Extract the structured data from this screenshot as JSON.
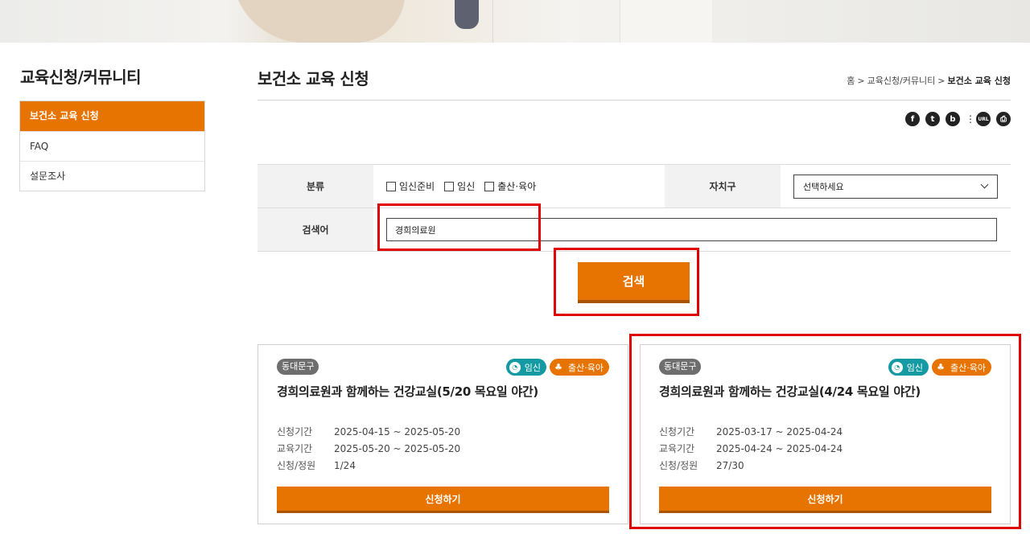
{
  "sidebar": {
    "title": "교육신청/커뮤니티",
    "items": [
      {
        "label": "보건소 교육 신청"
      },
      {
        "label": "FAQ"
      },
      {
        "label": "설문조사"
      }
    ]
  },
  "header": {
    "title": "보건소 교육 신청",
    "breadcrumb": [
      "홈",
      "교육신청/커뮤니티",
      "보건소 교육 신청"
    ],
    "breadcrumb_sep": ">"
  },
  "share": {
    "facebook": "f",
    "twitter": "t",
    "blog": "b",
    "more": "⋮",
    "url": "URL",
    "print": "⎙"
  },
  "search": {
    "category_label": "분류",
    "options": [
      "임신준비",
      "임신",
      "출산·육아"
    ],
    "district_label": "자치구",
    "district_value": "선택하세요",
    "keyword_label": "검색어",
    "keyword_value": "경희의료원",
    "button": "검색"
  },
  "results": [
    {
      "district": "동대문구",
      "tags": [
        "임신",
        "출산·육아"
      ],
      "title": "경희의료원과 함께하는 건강교실(5/20 목요일 야간)",
      "rows": [
        {
          "k": "신청기간",
          "v": "2025-04-15 ~ 2025-05-20"
        },
        {
          "k": "교육기간",
          "v": "2025-05-20 ~ 2025-05-20"
        },
        {
          "k": "신청/정원",
          "v": "1/24"
        }
      ],
      "button": "신청하기"
    },
    {
      "district": "동대문구",
      "tags": [
        "임신",
        "출산·육아"
      ],
      "title": "경희의료원과 함께하는 건강교실(4/24 목요일 야간)",
      "rows": [
        {
          "k": "신청기간",
          "v": "2025-03-17 ~ 2025-04-24"
        },
        {
          "k": "교육기간",
          "v": "2025-04-24 ~ 2025-04-24"
        },
        {
          "k": "신청/정원",
          "v": "27/30"
        }
      ],
      "button": "신청하기"
    }
  ],
  "colors": {
    "accent": "#e77300",
    "teal": "#149aa2",
    "highlight": "#e00000"
  }
}
